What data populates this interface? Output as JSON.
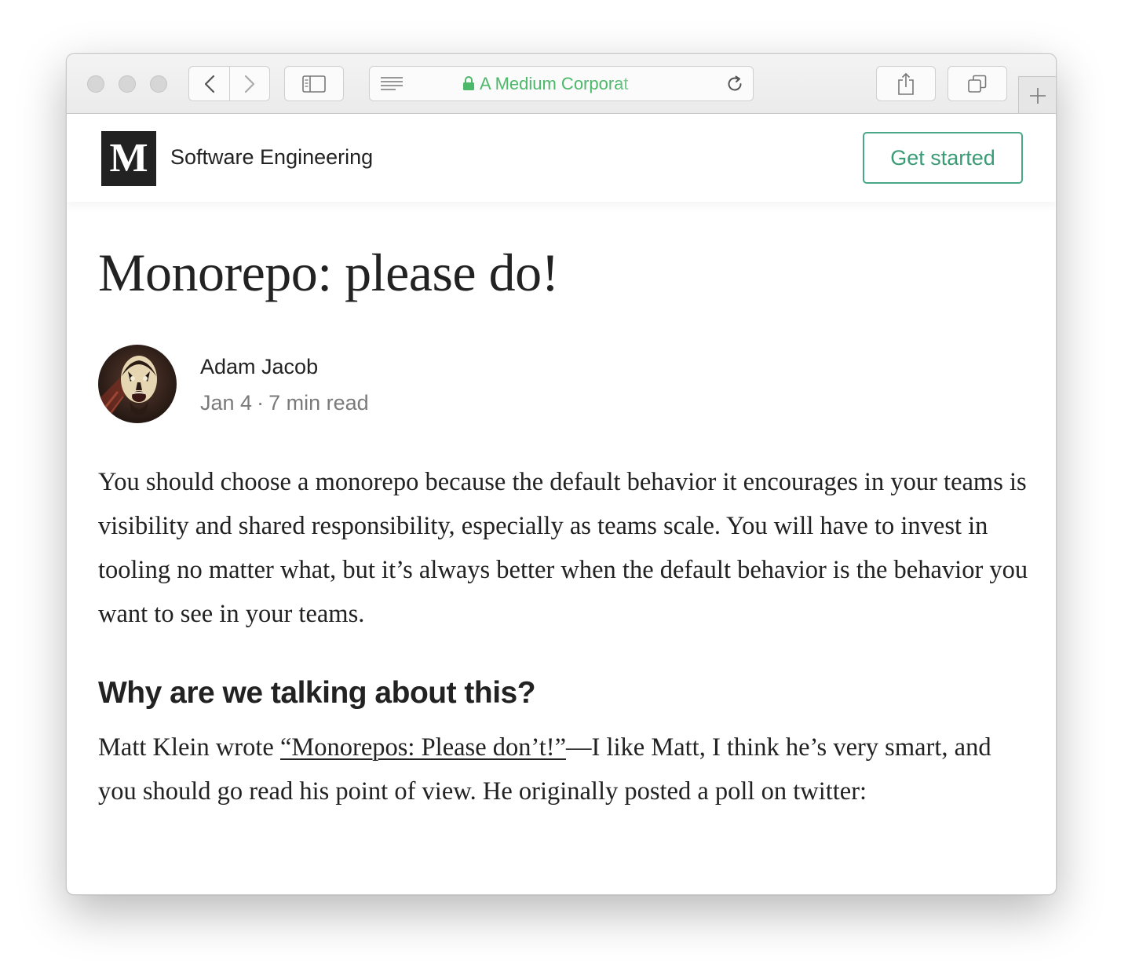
{
  "browser": {
    "address_text": "A Medium Corporat",
    "address_color": "#4cb86a",
    "icons": [
      "back-icon",
      "forward-icon",
      "sidebar-icon",
      "reader-icon",
      "lock-icon",
      "reload-icon",
      "share-icon",
      "tabs-icon",
      "plus-icon"
    ]
  },
  "header": {
    "logo_letter": "M",
    "publication": "Software Engineering",
    "cta_label": "Get started",
    "accent_color": "#48a785"
  },
  "article": {
    "title": "Monorepo: please do!",
    "author": "Adam Jacob",
    "date": "Jan 4",
    "separator": "·",
    "read_time": "7 min read",
    "intro": "You should choose a monorepo because the default behavior it encourages in your teams is visibility and shared responsibility, especially as teams scale. You will have to invest in tooling no matter what, but it’s always better when the default behavior is the behavior you want to see in your teams.",
    "section_heading": "Why are we talking about this?",
    "p2_before": "Matt Klein wrote ",
    "p2_link": "“Monorepos: Please don’t!”",
    "p2_after": "—I like Matt, I think he’s very smart, and you should go read his point of view. He originally posted a poll on twitter:"
  }
}
